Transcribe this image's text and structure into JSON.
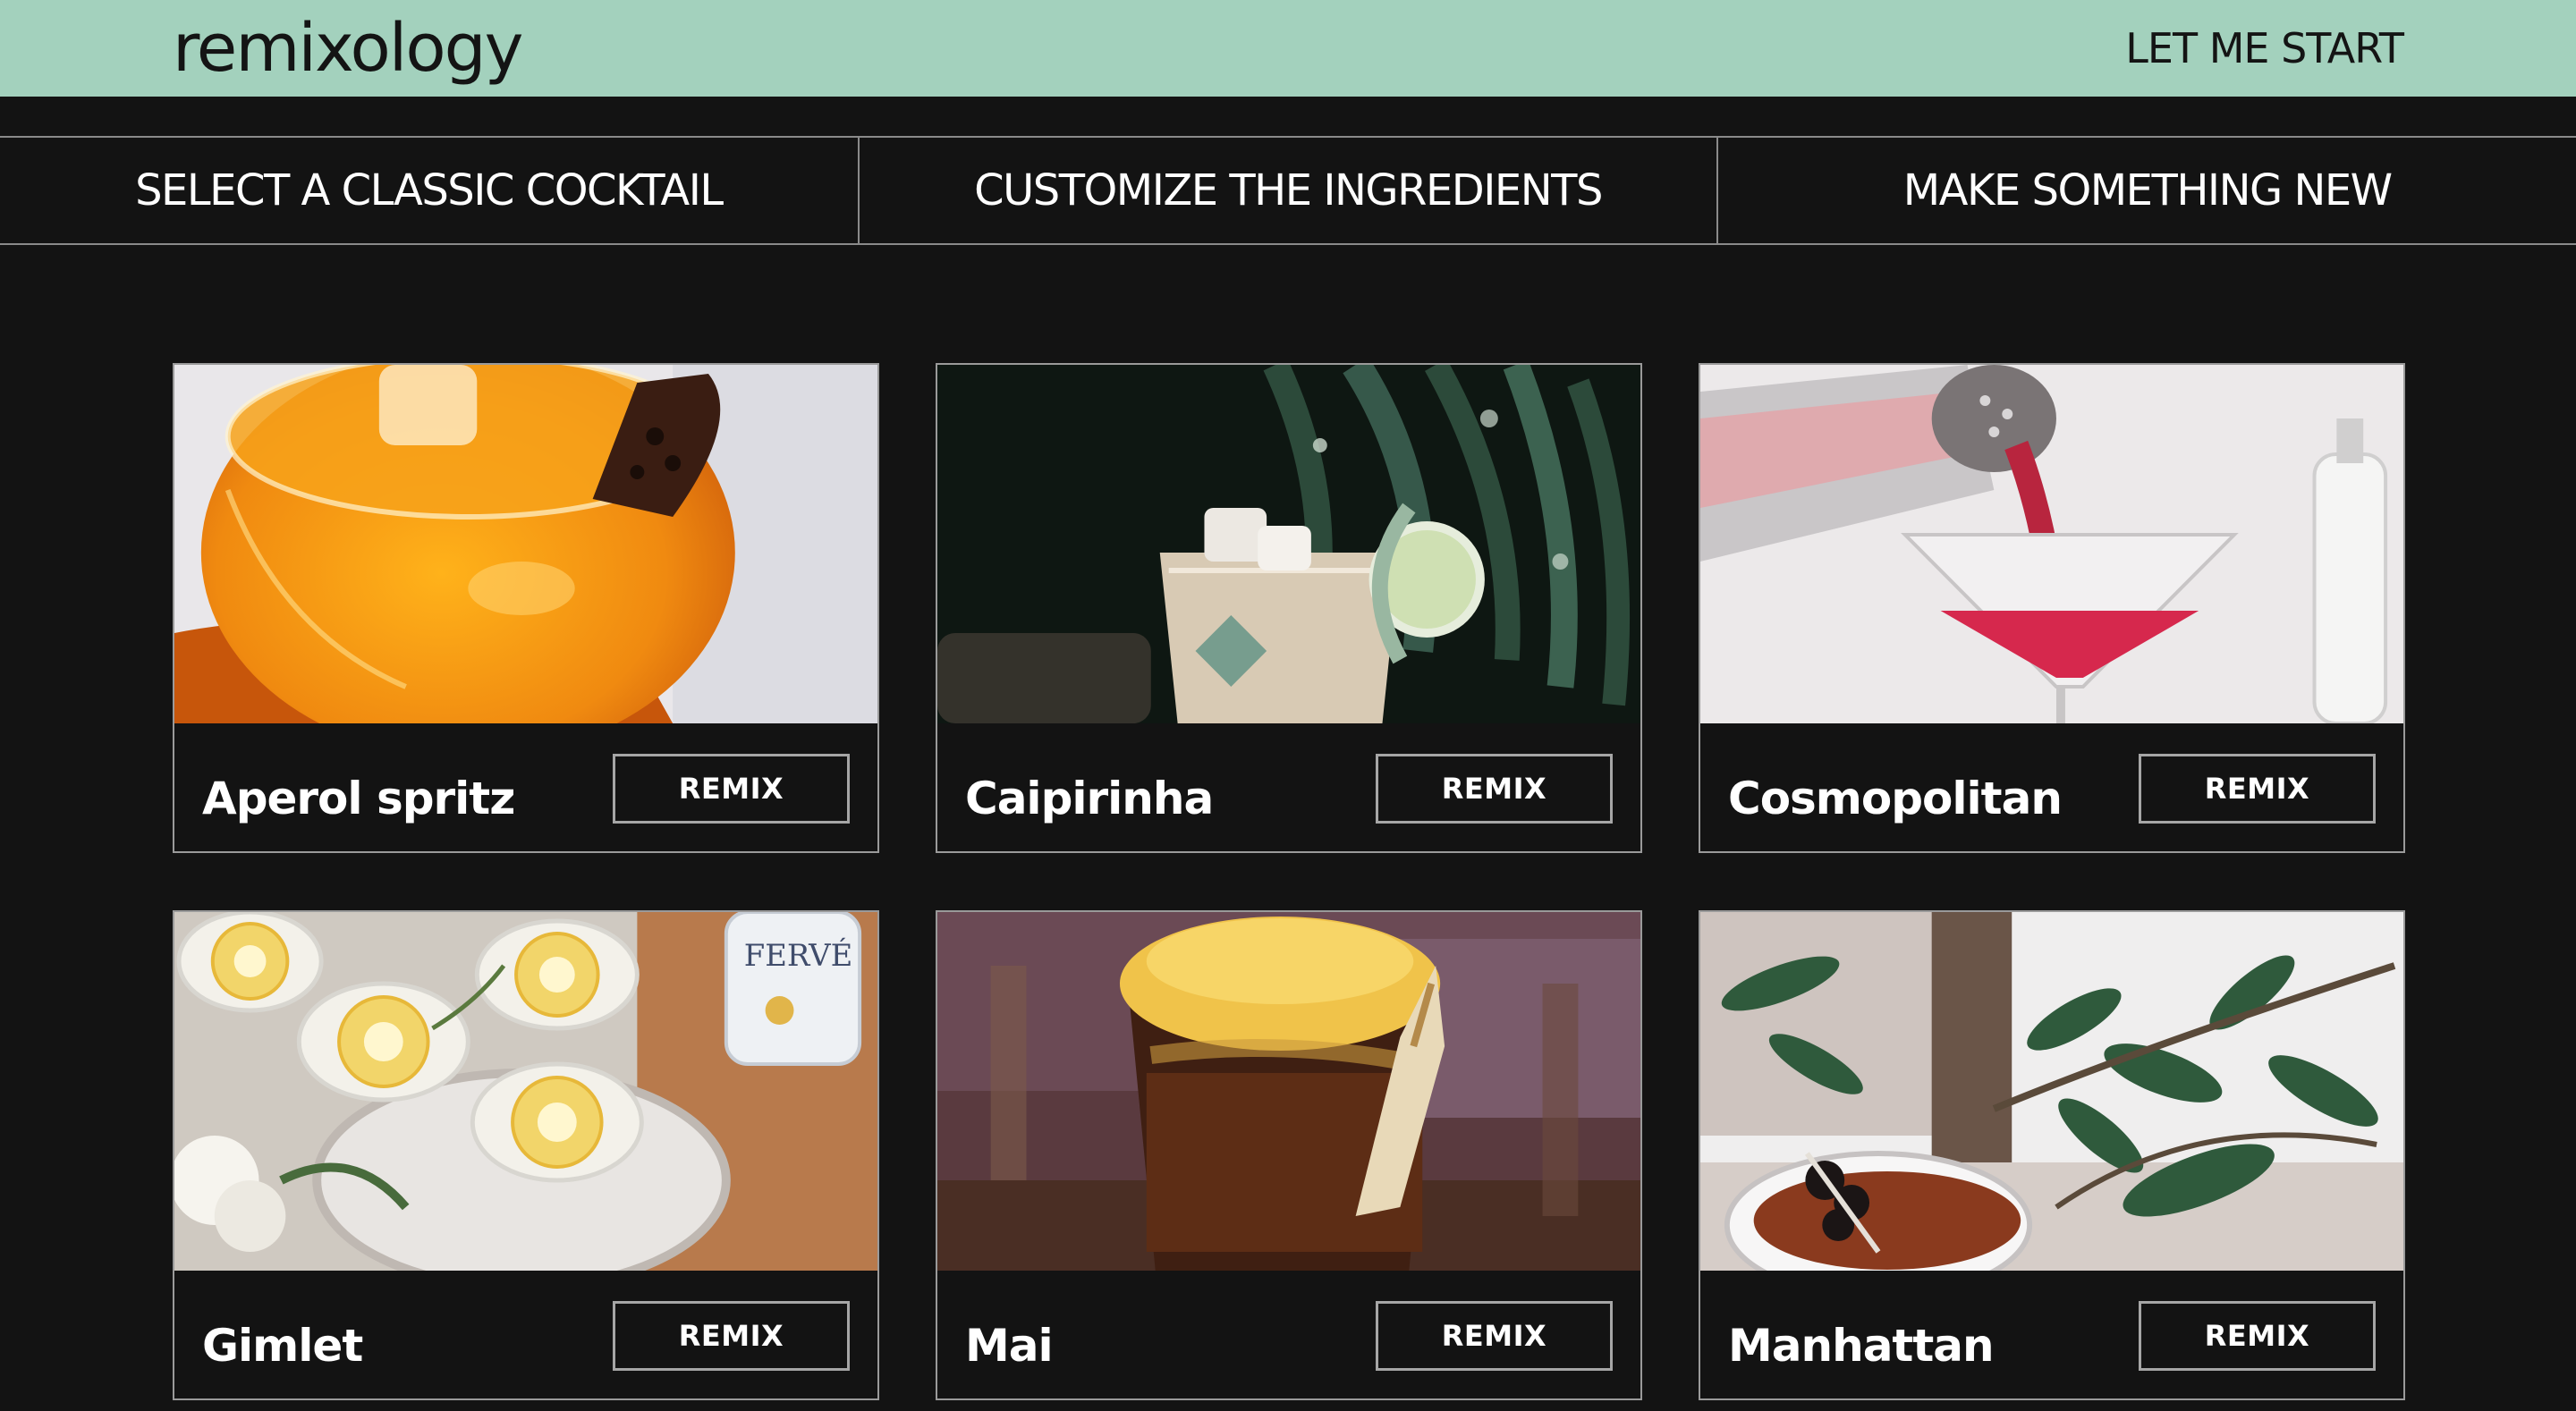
{
  "header": {
    "logo": "remixology",
    "start_link": "LET ME START",
    "background_color": "#a3d1bd"
  },
  "steps": [
    {
      "label": "SELECT A CLASSIC COCKTAIL"
    },
    {
      "label": "CUSTOMIZE THE INGREDIENTS"
    },
    {
      "label": "MAKE SOMETHING NEW"
    }
  ],
  "cocktails": [
    {
      "name": "Aperol spritz",
      "button": "REMIX",
      "photo_icon": "aperol-spritz-photo"
    },
    {
      "name": "Caipirinha",
      "button": "REMIX",
      "photo_icon": "caipirinha-photo"
    },
    {
      "name": "Cosmopolitan",
      "button": "REMIX",
      "photo_icon": "cosmopolitan-photo"
    },
    {
      "name": "Gimlet",
      "button": "REMIX",
      "photo_icon": "gimlet-photo"
    },
    {
      "name": "Mai",
      "button": "REMIX",
      "photo_icon": "mai-tai-photo"
    },
    {
      "name": "Manhattan",
      "button": "REMIX",
      "photo_icon": "manhattan-photo"
    }
  ]
}
